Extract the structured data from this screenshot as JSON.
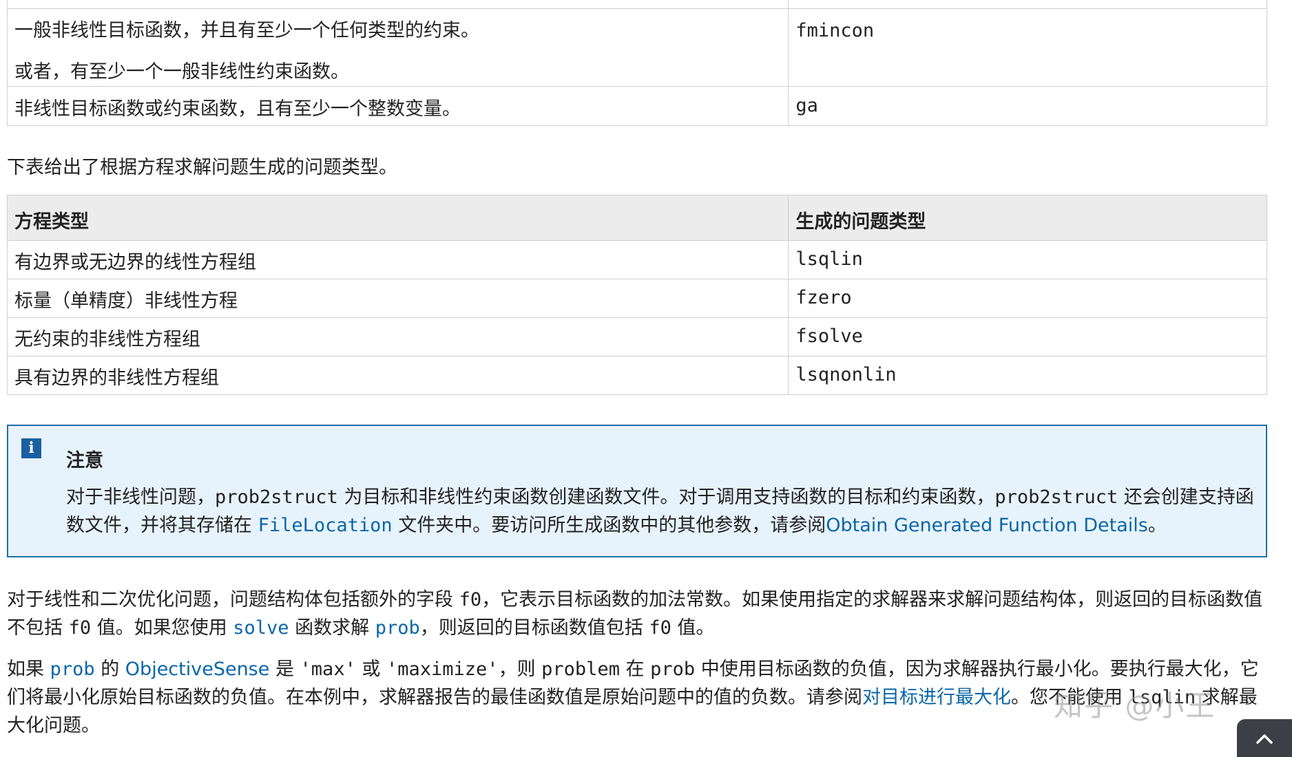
{
  "table1": {
    "rows": [
      {
        "desc1": "一般非线性目标函数，并且有至少一个任何类型的约束。",
        "desc2": "或者，有至少一个一般非线性约束函数。",
        "solver": "fmincon"
      },
      {
        "desc1": "非线性目标函数或约束函数，且有至少一个整数变量。",
        "solver": "ga"
      }
    ]
  },
  "intro": "下表给出了根据方程求解问题生成的问题类型。",
  "table2": {
    "headers": [
      "方程类型",
      "生成的问题类型"
    ],
    "rows": [
      {
        "eq": "有边界或无边界的线性方程组",
        "solver": "lsqlin"
      },
      {
        "eq": "标量（单精度）非线性方程",
        "solver": "fzero"
      },
      {
        "eq": "无约束的非线性方程组",
        "solver": "fsolve"
      },
      {
        "eq": "具有边界的非线性方程组",
        "solver": "lsqnonlin"
      }
    ]
  },
  "note": {
    "icon": "i",
    "title": "注意",
    "t1": "对于非线性问题，",
    "c1": "prob2struct",
    "t2": " 为目标和非线性约束函数创建函数文件。对于调用支持函数的目标和约束函数，",
    "c2": "prob2struct",
    "t3": " 还会创建支持函数文件，并将其存储在 ",
    "c3": "FileLocation",
    "t4": " 文件夹中。要访问所生成函数中的其他参数，请参阅",
    "link": "Obtain Generated Function Details",
    "t5": "。"
  },
  "para1": {
    "t1": "对于线性和二次优化问题，问题结构体包括额外的字段 ",
    "c1": "f0",
    "t2": "，它表示目标函数的加法常数。如果使用指定的求解器来求解问题结构体，则返回的目标函数值不包括 ",
    "c2": "f0",
    "t3": " 值。如果您使用 ",
    "c3": "solve",
    "t4": " 函数求解 ",
    "c4": "prob",
    "t5": "，则返回的目标函数值包括 ",
    "c5": "f0",
    "t6": " 值。"
  },
  "para2": {
    "t1": "如果 ",
    "c1": "prob",
    "t2": " 的 ",
    "link1": "ObjectiveSense",
    "t3": " 是 ",
    "c2": "'max'",
    "t4": " 或 ",
    "c3": "'maximize'",
    "t5": "，则 ",
    "c4": "problem",
    "t6": " 在 ",
    "c5": "prob",
    "t7": " 中使用目标函数的负值，因为求解器执行最小化。要执行最大化，它们将最小化原始目标函数的负值。在本例中，求解器报告的最佳函数值是原始问题中的值的负数。请参阅",
    "link2": "对目标进行最大化",
    "t8": "。您不能使用 ",
    "c6": "lsqlin",
    "t9": " 求解最大化问题。"
  },
  "watermark": "知乎 @小王",
  "colors": {
    "link": "#0a66a8",
    "note_bg": "#e7f3fc",
    "note_border": "#1e6fa5",
    "header_bg": "#ececec"
  }
}
